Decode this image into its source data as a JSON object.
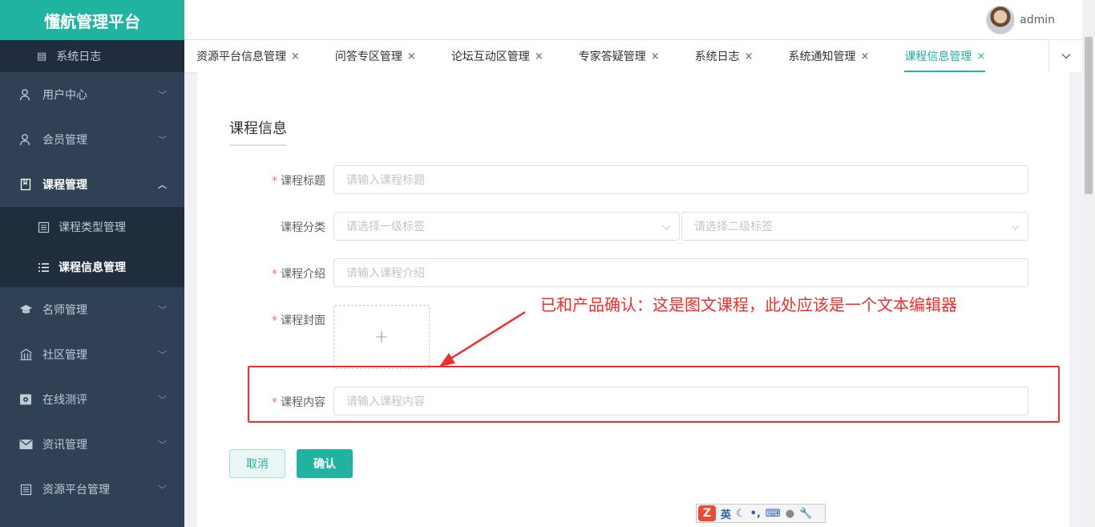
{
  "app": {
    "brand": "懂航管理平台"
  },
  "header": {
    "username": "admin"
  },
  "sidebar": {
    "top_sub_item": {
      "label": "系统日志",
      "icon": "document-icon"
    },
    "items": [
      {
        "label": "用户中心",
        "icon": "user-icon"
      },
      {
        "label": "会员管理",
        "icon": "member-icon"
      },
      {
        "label": "课程管理",
        "icon": "book-icon"
      },
      {
        "label": "名师管理",
        "icon": "graduation-cap-icon"
      },
      {
        "label": "社区管理",
        "icon": "building-icon"
      },
      {
        "label": "在线测评",
        "icon": "assessment-icon"
      },
      {
        "label": "资讯管理",
        "icon": "mail-icon"
      },
      {
        "label": "资源平台管理",
        "icon": "list-document-icon"
      }
    ],
    "course_sub": [
      {
        "label": "课程类型管理",
        "icon": "list-box-icon"
      },
      {
        "label": "课程信息管理",
        "icon": "list-icon"
      }
    ]
  },
  "tabs": [
    {
      "label": "资源平台信息管理",
      "close": "×"
    },
    {
      "label": "问答专区管理",
      "close": "×"
    },
    {
      "label": "论坛互动区管理",
      "close": "×"
    },
    {
      "label": "专家答疑管理",
      "close": "×"
    },
    {
      "label": "系统日志",
      "close": "×"
    },
    {
      "label": "系统通知管理",
      "close": "×"
    },
    {
      "label": "课程信息管理",
      "close": "×"
    }
  ],
  "form": {
    "title": "课程信息",
    "required_mark": "*",
    "course_title": {
      "label": "课程标题",
      "placeholder": "请输入课程标题"
    },
    "course_category": {
      "label": "课程分类",
      "primary_placeholder": "请选择一级标签",
      "secondary_placeholder": "请选择二级标签"
    },
    "course_intro": {
      "label": "课程介绍",
      "placeholder": "请输入课程介绍"
    },
    "course_cover": {
      "label": "课程封面",
      "upload_symbol": "+"
    },
    "course_content": {
      "label": "课程内容",
      "placeholder": "请输入课程内容"
    },
    "cancel_label": "取消",
    "confirm_label": "确认"
  },
  "annotation": {
    "text": "已和产品确认：这是图文课程，此处应该是一个文本编辑器",
    "color": "#f52c2c"
  },
  "ime": {
    "logo": "Z",
    "mode": "英"
  },
  "colors": {
    "accent": "#1fb3a0",
    "sidebar_bg": "#304156",
    "sidebar_sub_bg": "#1f2d3d"
  }
}
